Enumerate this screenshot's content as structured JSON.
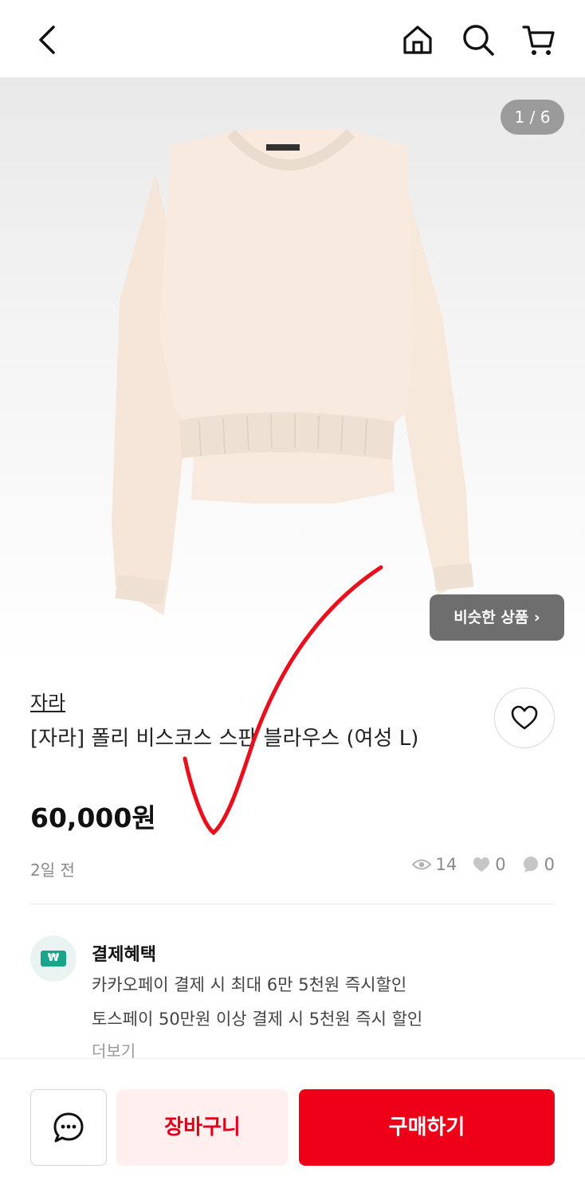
{
  "header": {
    "back_icon": "chevron-left-icon",
    "home_icon": "home-icon",
    "search_icon": "search-icon",
    "cart_icon": "cart-icon"
  },
  "gallery": {
    "counter": "1 / 6",
    "similar_button": "비슷한 상품 ›"
  },
  "product": {
    "brand": "자라",
    "title": "[자라] 폴리 비스코스 스판 블라우스 (여성 L)",
    "price": "60,000원",
    "posted": "2일 전",
    "views": "14",
    "likes": "0",
    "comments": "0"
  },
  "benefits": {
    "title": "결제혜택",
    "lines": [
      "카카오페이 결제 시 최대 6만 5천원 즉시할인",
      "토스페이 50만원 이상 결제 시 5천원 즉시 할인"
    ],
    "more": "더보기",
    "icon_text": "₩"
  },
  "bottom": {
    "cart_label": "장바구니",
    "buy_label": "구매하기"
  },
  "colors": {
    "accent": "#ee0018",
    "cart_bg": "#fff0ef",
    "badge_bg": "#6e6e6e",
    "benefit_green": "#1aa58b"
  }
}
